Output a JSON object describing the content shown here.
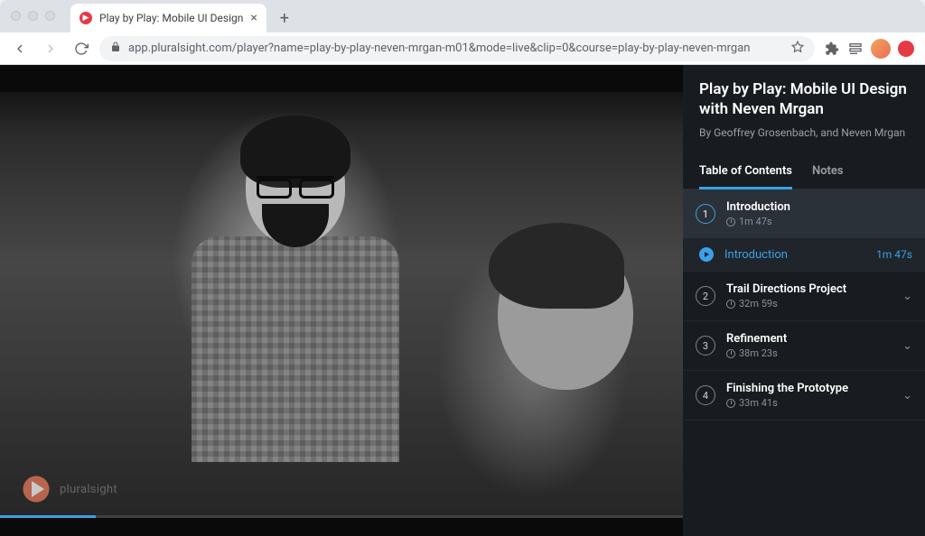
{
  "browser": {
    "tab_title": "Play by Play: Mobile UI Design",
    "url": "app.pluralsight.com/player?name=play-by-play-neven-mrgan-m01&mode=live&clip=0&course=play-by-play-neven-mrgan"
  },
  "watermark": {
    "text": "pluralsight"
  },
  "course": {
    "title": "Play by Play: Mobile UI Design with Neven Mrgan",
    "authors": "By Geoffrey Grosenbach, and Neven Mrgan"
  },
  "tabs": {
    "toc": "Table of Contents",
    "notes": "Notes"
  },
  "modules": [
    {
      "num": "1",
      "title": "Introduction",
      "duration": "1m 47s",
      "expanded": true,
      "clips": [
        {
          "title": "Introduction",
          "duration": "1m 47s"
        }
      ]
    },
    {
      "num": "2",
      "title": "Trail Directions Project",
      "duration": "32m 59s",
      "expanded": false
    },
    {
      "num": "3",
      "title": "Refinement",
      "duration": "38m 23s",
      "expanded": false
    },
    {
      "num": "4",
      "title": "Finishing the Prototype",
      "duration": "33m 41s",
      "expanded": false
    }
  ]
}
